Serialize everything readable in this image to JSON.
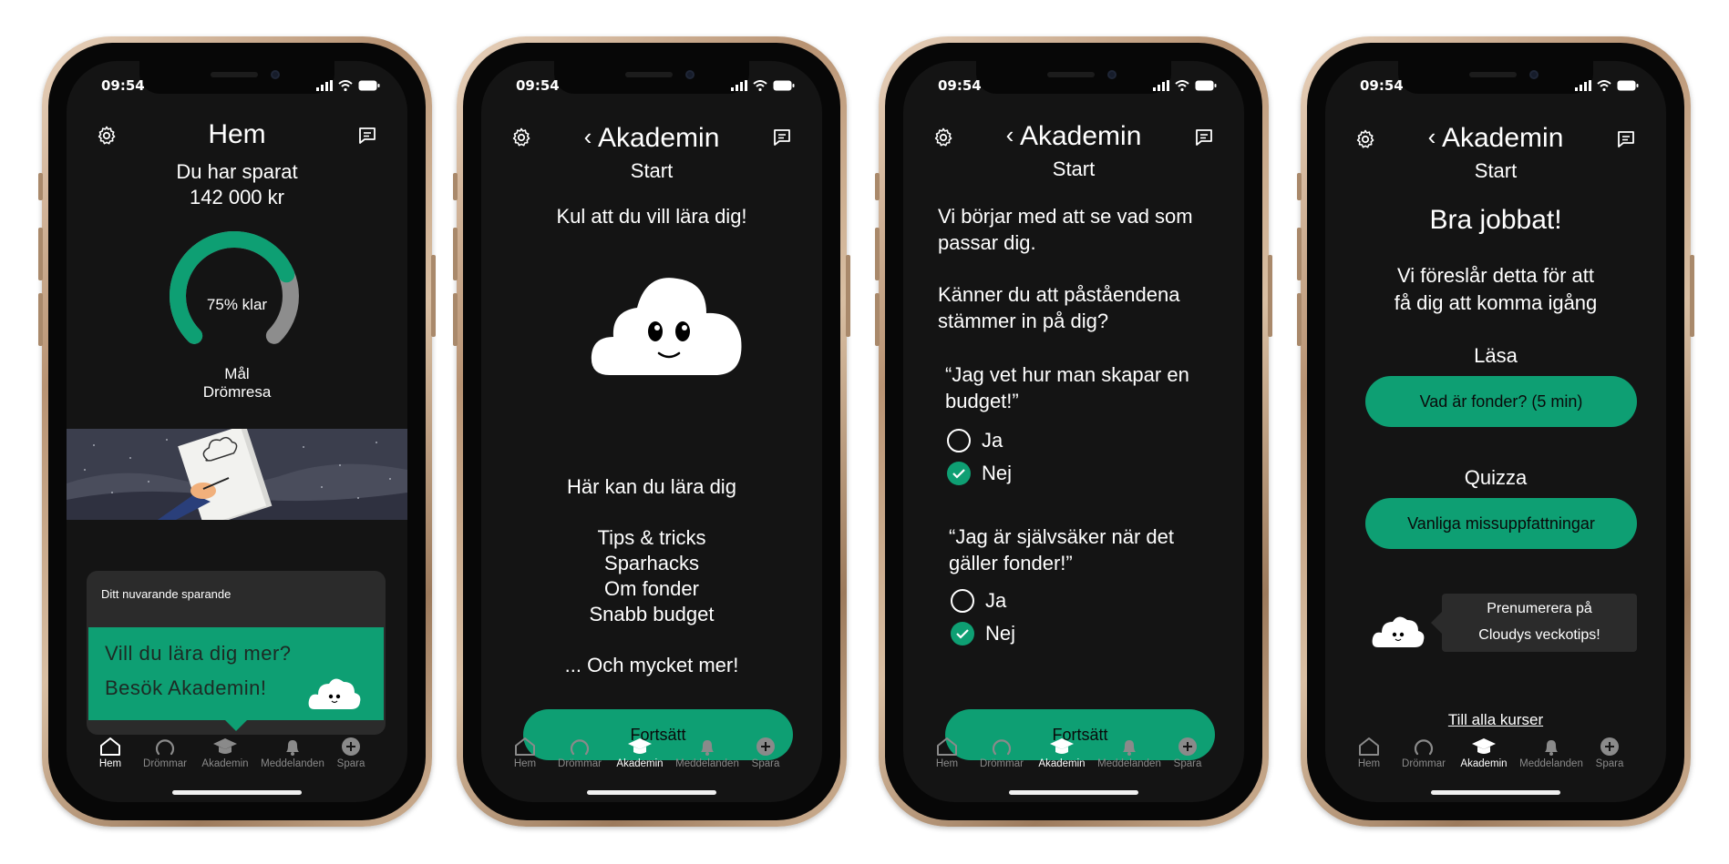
{
  "status_time": "09:54",
  "tabs": [
    "Hem",
    "Drömmar",
    "Akademin",
    "Meddelanden",
    "Spara"
  ],
  "colors": {
    "accent": "#0e9f73",
    "background": "#141414",
    "gauge_rest": "#8d8d8d"
  },
  "screen1": {
    "title": "Hem",
    "saved_label": "Du har sparat",
    "saved_amount": "142 000 kr",
    "progress": 0.75,
    "progress_label": "75% klar",
    "goal_label": "Mål",
    "goal_name": "Drömresa",
    "card_title": "Ditt nuvarande sparande",
    "tooltip_line1": "Vill du lära dig mer?",
    "tooltip_line2": "Besök Akademin!",
    "active_tab": "Hem"
  },
  "screen2": {
    "title": "Akademin",
    "subtitle": "Start",
    "welcome": "Kul att du vill lära dig!",
    "learn_heading": "Här kan du lära dig",
    "topics": [
      "Tips & tricks",
      "Sparhacks",
      "Om fonder",
      "Snabb budget"
    ],
    "more": "... Och mycket mer!",
    "button": "Fortsätt",
    "active_tab": "Akademin"
  },
  "screen3": {
    "title": "Akademin",
    "subtitle": "Start",
    "intro": "Vi börjar med att se vad som passar dig.",
    "question": "Känner du att påståendena stämmer in på dig?",
    "statement1": "“Jag vet hur man skapar en budget!”",
    "statement2": "“Jag är självsäker när det gäller fonder!”",
    "option_yes": "Ja",
    "option_no": "Nej",
    "answer1": "Nej",
    "answer2": "Nej",
    "button": "Fortsätt",
    "active_tab": "Akademin"
  },
  "screen4": {
    "title": "Akademin",
    "subtitle": "Start",
    "heading": "Bra jobbat!",
    "suggestion_line1": "Vi föreslår detta för att",
    "suggestion_line2": "få dig att komma igång",
    "read_label": "Läsa",
    "read_button": "Vad är fonder? (5 min)",
    "quiz_label": "Quizza",
    "quiz_button": "Vanliga missuppfattningar",
    "subscribe_line1": "Prenumerera på",
    "subscribe_line2": "Cloudys veckotips!",
    "all_courses_link": "Till alla kurser",
    "active_tab": "Akademin"
  }
}
